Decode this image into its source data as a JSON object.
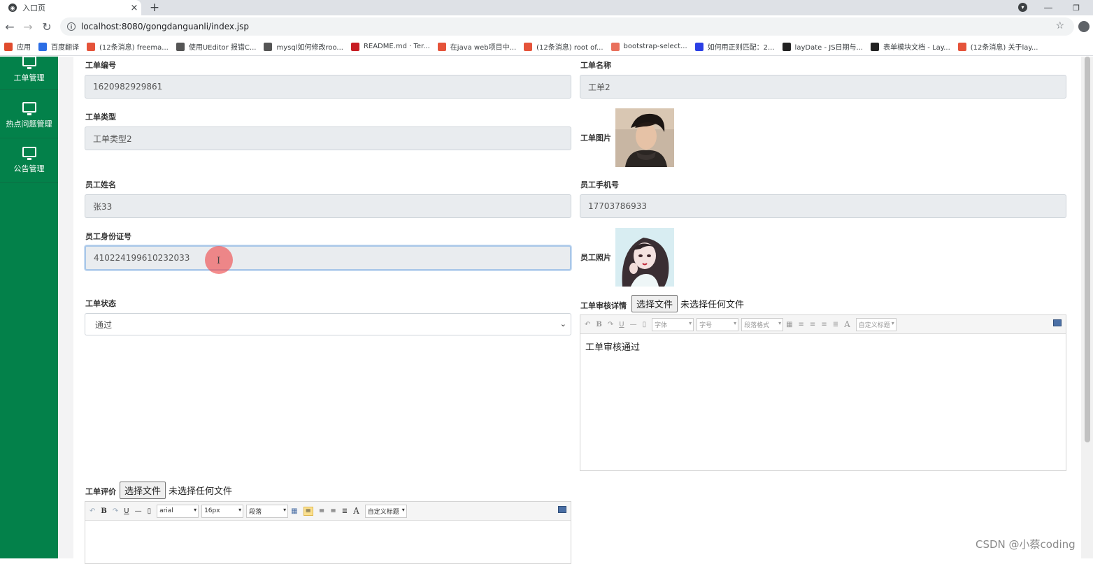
{
  "browser": {
    "tab_title": "入口页",
    "tab_close": "×",
    "new_tab": "+",
    "url": "localhost:8080/gongdanguanli/index.jsp",
    "bookmarks": [
      {
        "label": "应用",
        "icon": "apps-grid-icon",
        "color": "#e04b2d"
      },
      {
        "label": "百度翻译",
        "icon": "baidu-translate-icon",
        "color": "#2b6de5"
      },
      {
        "label": "(12条消息) freema...",
        "icon": "csdn-icon",
        "color": "#e5533a"
      },
      {
        "label": "使用UEditor 报错C...",
        "icon": "yuque-icon",
        "color": "#555555"
      },
      {
        "label": "mysql如何修改roo...",
        "icon": "yuque-icon",
        "color": "#555555"
      },
      {
        "label": "README.md · Ter...",
        "icon": "gitee-icon",
        "color": "#c71d23"
      },
      {
        "label": "在java web项目中...",
        "icon": "csdn-icon",
        "color": "#e5533a"
      },
      {
        "label": "(12条消息) root of...",
        "icon": "csdn-icon",
        "color": "#e5533a"
      },
      {
        "label": "bootstrap-select...",
        "icon": "jianshu-icon",
        "color": "#e9705c"
      },
      {
        "label": "如何用正则匹配：2...",
        "icon": "baidu-paw-icon",
        "color": "#2b3fe5"
      },
      {
        "label": "layDate - JS日期与...",
        "icon": "layui-icon",
        "color": "#222222"
      },
      {
        "label": "表单模块文档 - Lay...",
        "icon": "layui-icon",
        "color": "#222222"
      },
      {
        "label": "(12条消息) 关于lay...",
        "icon": "csdn-icon",
        "color": "#e5533a"
      }
    ]
  },
  "sidebar": {
    "accent": "#03814a",
    "items": [
      {
        "label": "工单管理",
        "icon": "monitor-icon"
      },
      {
        "label": "热点问题管理",
        "icon": "monitor-icon"
      },
      {
        "label": "公告管理",
        "icon": "monitor-icon"
      }
    ]
  },
  "form": {
    "order_no": {
      "label": "工单编号",
      "value": "1620982929861"
    },
    "order_name": {
      "label": "工单名称",
      "value": "工单2"
    },
    "order_type": {
      "label": "工单类型",
      "value": "工单类型2"
    },
    "order_image": {
      "label": "工单图片"
    },
    "employee_name": {
      "label": "员工姓名",
      "value": "张33"
    },
    "employee_phone": {
      "label": "员工手机号",
      "value": "17703786933"
    },
    "employee_id": {
      "label": "员工身份证号",
      "value": "410224199610232033"
    },
    "employee_photo": {
      "label": "员工照片"
    },
    "order_status": {
      "label": "工单状态",
      "value": "通过"
    },
    "review_detail": {
      "label": "工单审核详情",
      "file_button": "选择文件",
      "file_status": "未选择任何文件",
      "content": "工单审核通过",
      "toolbar": {
        "font": "字体",
        "size": "字号",
        "para": "段落格式",
        "custom": "自定义标题",
        "text_a": "A",
        "bold": "B",
        "underline": "U"
      }
    },
    "evaluation": {
      "label": "工单评价",
      "file_button": "选择文件",
      "file_status": "未选择任何文件",
      "toolbar": {
        "font": "arial",
        "size": "16px",
        "para": "段落",
        "custom": "自定义标题",
        "text_a": "A",
        "bold": "B",
        "underline": "U"
      }
    }
  },
  "watermark": "CSDN @小蔡coding"
}
